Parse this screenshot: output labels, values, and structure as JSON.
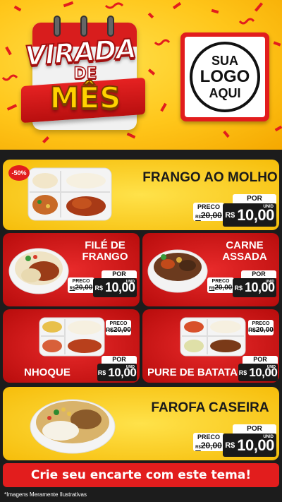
{
  "header": {
    "title_line1": "VIRADA",
    "title_line2": "DE",
    "title_line3": "MÊS",
    "logo_line1": "SUA",
    "logo_line2": "LOGO",
    "logo_line3": "AQUI"
  },
  "colors": {
    "yellow": "#ffc61a",
    "red": "#e21d1d",
    "dark": "#1a1a1a"
  },
  "products": [
    {
      "name": "FRANGO AO MOLHO",
      "discount": "-50%",
      "preco_label": "PRECO",
      "old_price": "20,00",
      "old_prefix": "R$",
      "por_label": "POR",
      "currency": "R$",
      "price": "10,00",
      "unit": "UNID"
    },
    {
      "name_line1": "FILÉ DE",
      "name_line2": "FRANGO",
      "preco_label": "PRECO",
      "old_price": "20,00",
      "old_prefix": "R$",
      "por_label": "POR",
      "currency": "R$",
      "price": "10,00",
      "unit": "UNID"
    },
    {
      "name_line1": "CARNE",
      "name_line2": "ASSADA",
      "preco_label": "PRECO",
      "old_price": "20,00",
      "old_prefix": "R$",
      "por_label": "POR",
      "currency": "R$",
      "price": "10,00",
      "unit": "UNID"
    },
    {
      "name": "NHOQUE",
      "preco_label": "PRECO",
      "old_price": "20,00",
      "old_prefix": "R$",
      "por_label": "POR",
      "currency": "R$",
      "price": "10,00",
      "unit": "UNID"
    },
    {
      "name": "PURE DE BATATA",
      "preco_label": "PRECO",
      "old_price": "20,00",
      "old_prefix": "R$",
      "por_label": "POR",
      "currency": "R$",
      "price": "10,00",
      "unit": "UNID"
    },
    {
      "name": "FAROFA CASEIRA",
      "preco_label": "PRECO",
      "old_price": "20,00",
      "old_prefix": "R$",
      "por_label": "POR",
      "currency": "R$",
      "price": "10,00",
      "unit": "UNID"
    }
  ],
  "banner": "Crie seu encarte com este tema!",
  "footnote": "*Imagens Meramente Ilustrativas"
}
